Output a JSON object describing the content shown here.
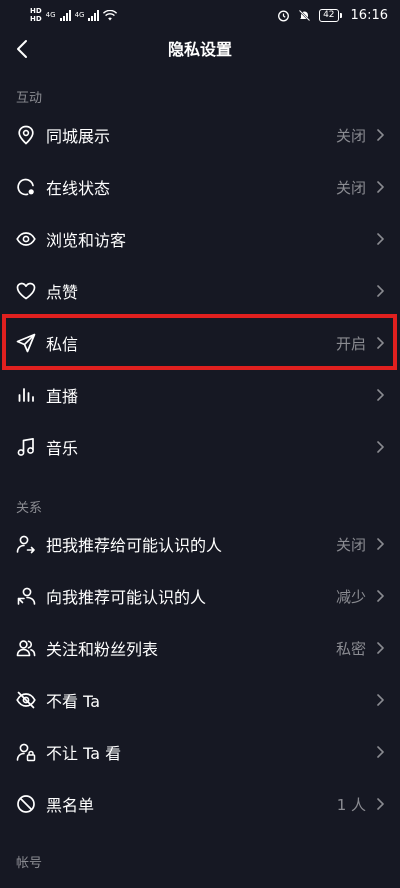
{
  "status_bar": {
    "network": "4G",
    "signal_label": "HD",
    "battery": "42",
    "time": "16:16"
  },
  "header": {
    "title": "隐私设置"
  },
  "sections": [
    {
      "title": "互动",
      "items": [
        {
          "label": "同城展示",
          "value": "关闭",
          "icon": "location-pin-icon"
        },
        {
          "label": "在线状态",
          "value": "关闭",
          "icon": "online-status-icon"
        },
        {
          "label": "浏览和访客",
          "value": "",
          "icon": "eye-icon"
        },
        {
          "label": "点赞",
          "value": "",
          "icon": "heart-icon"
        },
        {
          "label": "私信",
          "value": "开启",
          "icon": "send-icon"
        },
        {
          "label": "直播",
          "value": "",
          "icon": "live-bars-icon"
        },
        {
          "label": "音乐",
          "value": "",
          "icon": "music-note-icon"
        }
      ]
    },
    {
      "title": "关系",
      "items": [
        {
          "label": "把我推荐给可能认识的人",
          "value": "关闭",
          "icon": "user-share-icon"
        },
        {
          "label": "向我推荐可能认识的人",
          "value": "减少",
          "icon": "user-recommend-icon"
        },
        {
          "label": "关注和粉丝列表",
          "value": "私密",
          "icon": "users-icon"
        },
        {
          "label": "不看 Ta",
          "value": "",
          "icon": "eye-off-icon"
        },
        {
          "label": "不让 Ta 看",
          "value": "",
          "icon": "user-lock-icon"
        },
        {
          "label": "黑名单",
          "value": "1 人",
          "icon": "block-icon"
        }
      ]
    },
    {
      "title": "帐号",
      "items": []
    }
  ],
  "colors": {
    "background": "#161823",
    "secondary_text": "#8a8b91",
    "highlight": "#e0201f"
  }
}
